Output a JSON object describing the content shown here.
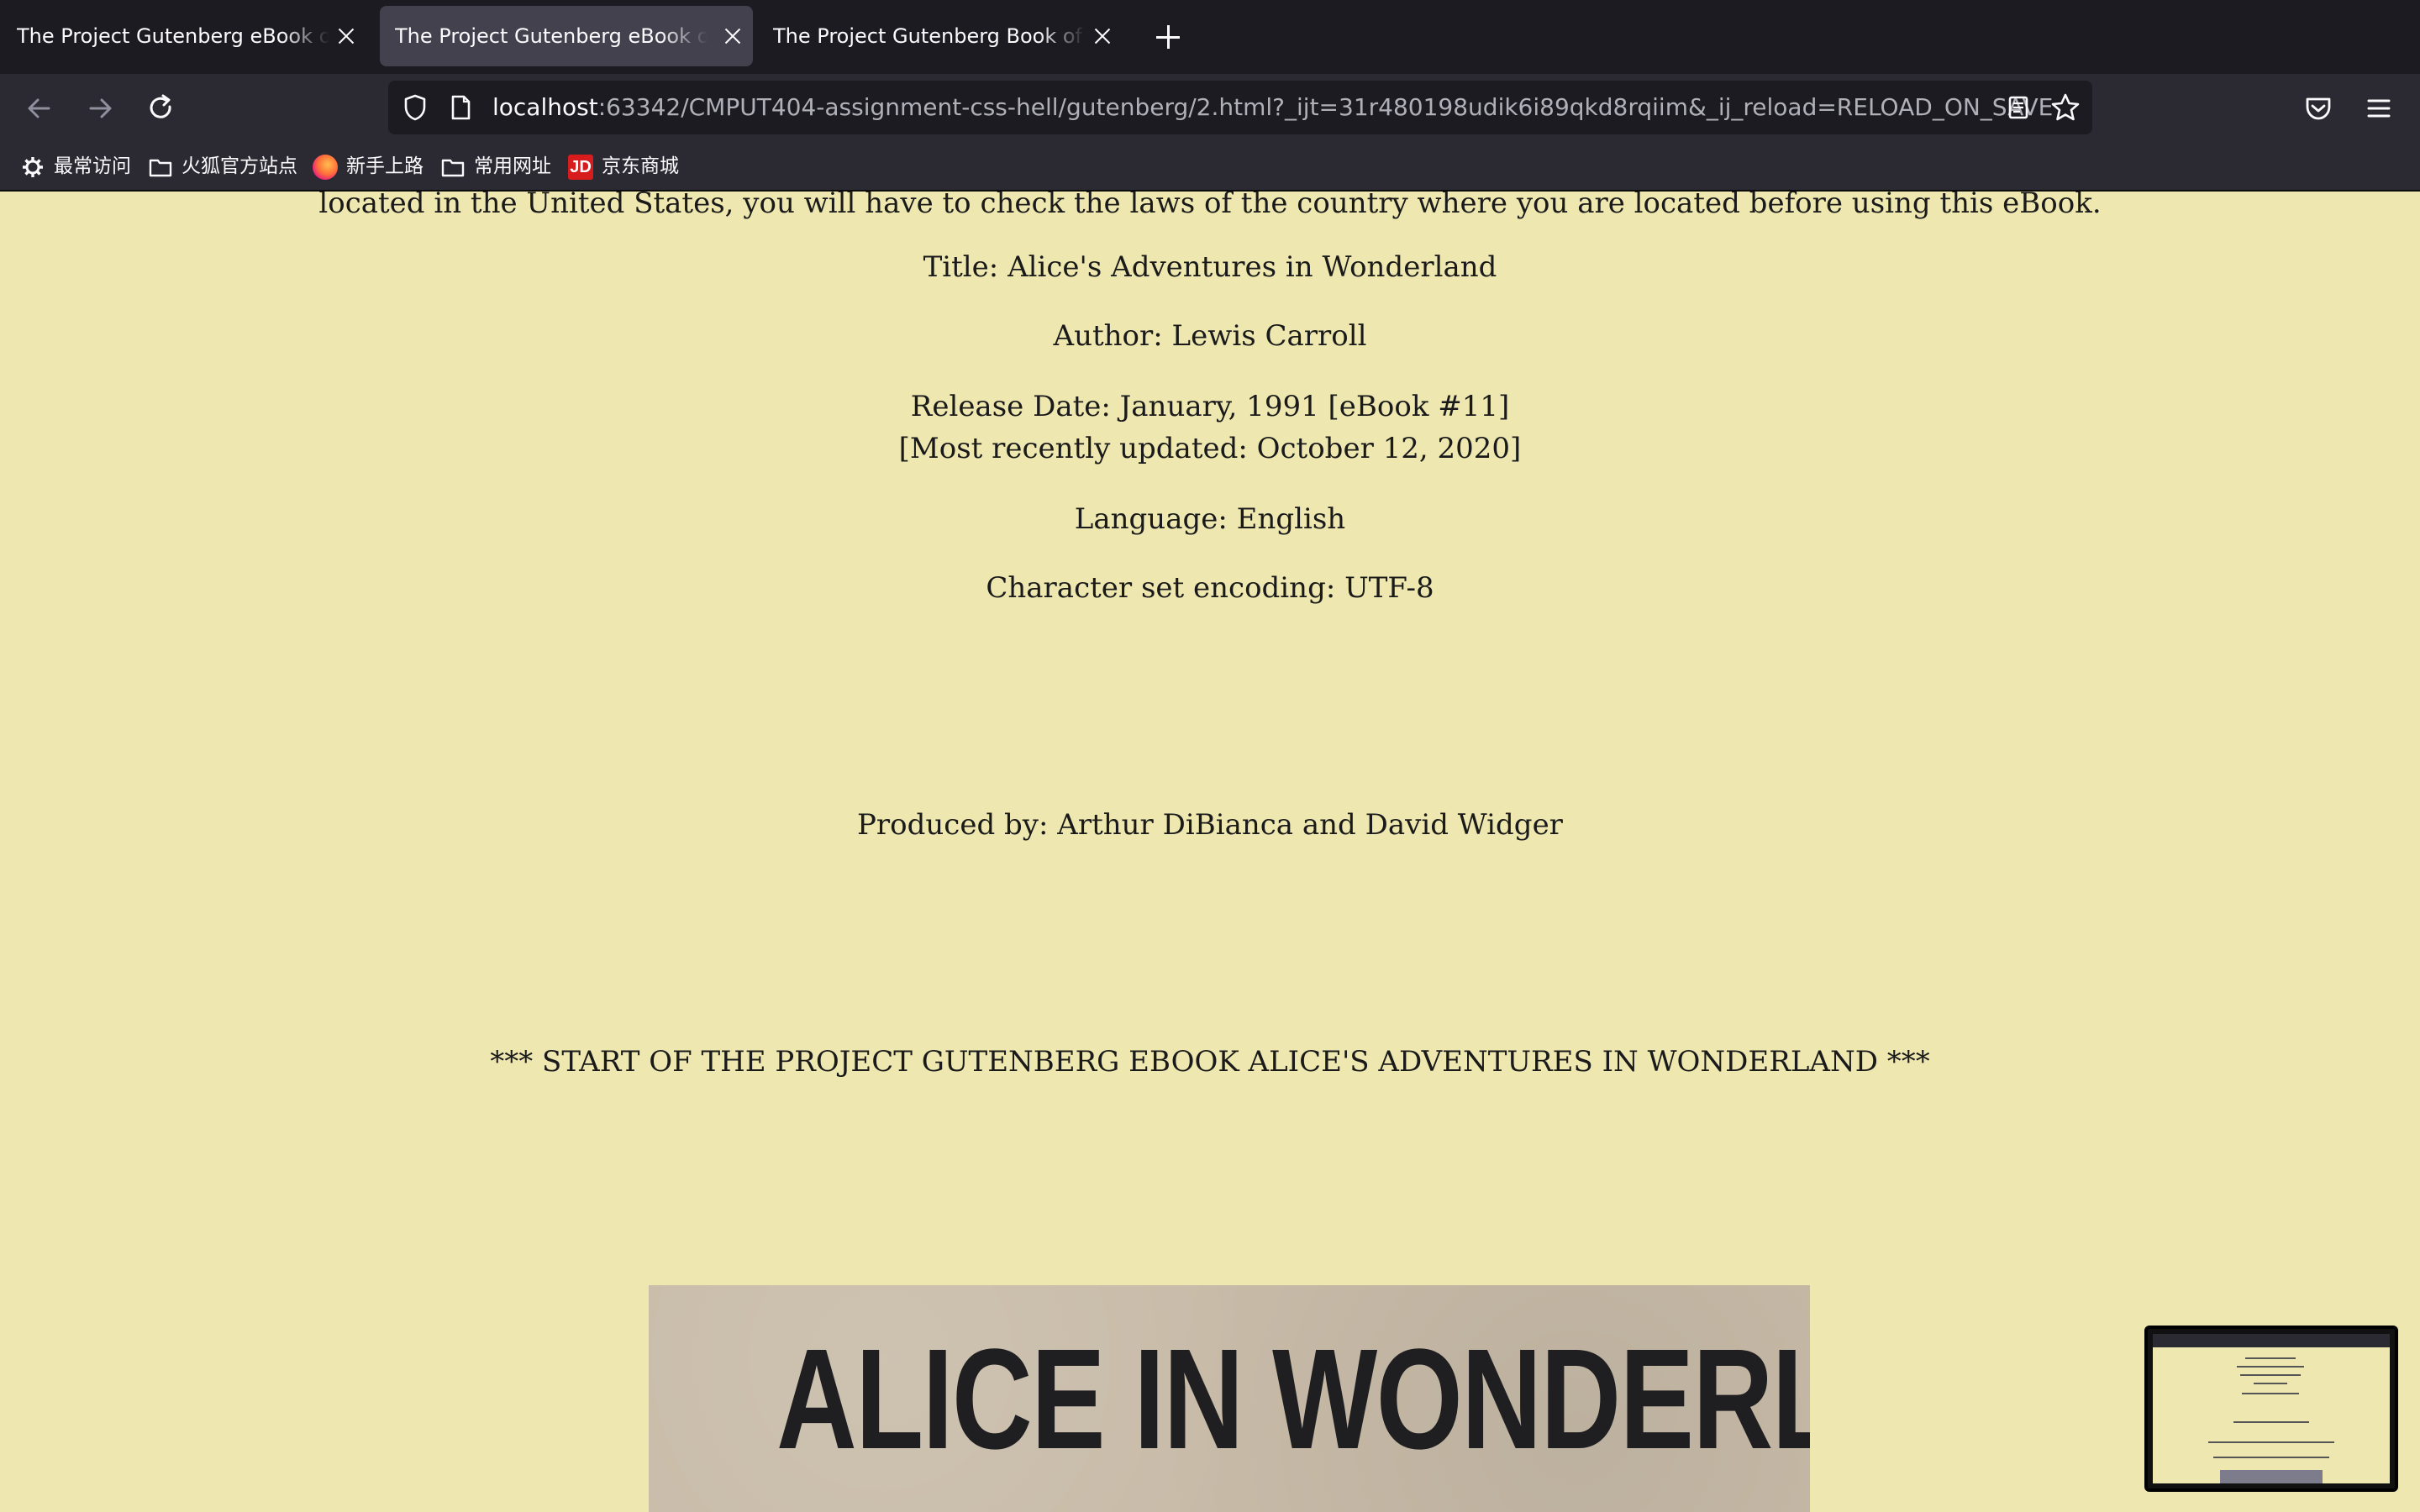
{
  "tabs": [
    {
      "title": "The Project Gutenberg eBook of Pride and Prejudice",
      "active": false
    },
    {
      "title": "The Project Gutenberg eBook of Alice's Adventures in Wonderland",
      "active": true
    },
    {
      "title": "The Project Gutenberg Book of The Jungle",
      "active": false
    }
  ],
  "navbar": {
    "url_host": "localhost",
    "url_rest": ":63342/CMPUT404-assignment-css-hell/gutenberg/2.html?_ijt=31r480198udik6i89qkd8rqiim&_ij_reload=RELOAD_ON_SAVE"
  },
  "bookmarks": [
    {
      "label": "最常访问",
      "icon": "gear-icon"
    },
    {
      "label": "火狐官方站点",
      "icon": "folder-icon"
    },
    {
      "label": "新手上路",
      "icon": "firefox-icon"
    },
    {
      "label": "常用网址",
      "icon": "folder-icon"
    },
    {
      "label": "京东商城",
      "icon": "jd-icon"
    }
  ],
  "content": {
    "intro_tail": "located in the United States, you will have to check the laws of the country where you are located before using this eBook.",
    "title_line": "Title: Alice's Adventures in Wonderland",
    "author_line": "Author: Lewis Carroll",
    "release_line": "Release Date: January, 1991 [eBook #11]",
    "updated_line": "[Most recently updated: October 12, 2020]",
    "language_line": "Language: English",
    "encoding_line": "Character set encoding: UTF-8",
    "produced_line": "Produced by: Arthur DiBianca and David Widger",
    "start_marker": "*** START OF THE PROJECT GUTENBERG EBOOK ALICE'S ADVENTURES IN WONDERLAND ***",
    "image_title": "ALICE IN WONDERLAND"
  },
  "colors": {
    "page_background": "#eee8b0",
    "chrome_dark": "#1c1b22",
    "chrome_toolbar": "#2b2a33"
  }
}
